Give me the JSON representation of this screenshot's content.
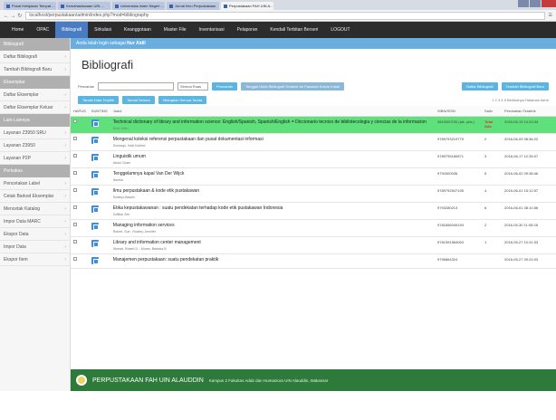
{
  "browser": {
    "tabs": [
      {
        "label": "Pusat Kebijakan Tempat ..."
      },
      {
        "label": "Kemahasiswaan UIN ..."
      },
      {
        "label": "Universitas Islam Negeri ..."
      },
      {
        "label": "Jurnal Ilmu Perpustakaan"
      },
      {
        "label": "Perpustakaan FAH UIN A..."
      }
    ],
    "url": "localhost/perpustakaan/admin/index.php?mod=bibliography",
    "nav_icons": "← → ↻"
  },
  "topnav": {
    "items": [
      "Home",
      "OPAC",
      "Bibliografi",
      "Sirkulasi",
      "Keanggotaan",
      "Master File",
      "Inventarisasi",
      "Pelaporan",
      "Kendali Terbitan Berseri",
      "LOGOUT"
    ]
  },
  "sidebar": {
    "sections": [
      {
        "heading": "Bibliografi",
        "items": [
          "Daftar Bibliografi",
          "Tambah Bibliografi Baru"
        ]
      },
      {
        "heading": "Eksemplar",
        "items": [
          "Daftar Eksemplar",
          "Daftar Eksemplar Keluar"
        ]
      },
      {
        "heading": "Lain-Lainnya",
        "items": [
          "Layanan Z3950 SRU",
          "Layanan Z3950",
          "Layanan P2P"
        ]
      },
      {
        "heading": "Perkakas",
        "items": [
          "Pencetakan Label",
          "Cetak Barkod Eksemplar",
          "Mencetak Katalog",
          "Impor Data MARC",
          "Ekspor Data",
          "Impor Data",
          "Ekspor Item"
        ]
      }
    ]
  },
  "main": {
    "info": "Anda telah login sebagai",
    "info_user": "Nur Aidil",
    "title": "Bibliografi",
    "search_label": "Pencarian",
    "search_placeholder": "",
    "search_select": "Semua Ruas",
    "btn_search": "Pencarian",
    "btn_search_pattern": "Tanggal Ubah Bibliografi Terakhir ke Pasukan Kolom Induk",
    "btn_list": "Daftar Bibliografi",
    "btn_add": "Tambah Bibliografi Baru",
    "btn_select_all": "Tandai Data Terpilih",
    "btn_clear": "Tandai Semua",
    "btn_unmark": "Hilangkan Semua Tanda",
    "pager": "1 2 3 4 5 Berikutnya Halaman Akhir",
    "columns": [
      "HAPUS",
      "SUNTING",
      "Judul",
      "ISBN/ISSN",
      "Salin",
      "Perubahan Terakhir"
    ],
    "rows": [
      {
        "title": "Technical dictionary of library and information science: English/Spanish, Spanish/English = Diccionario tecnico de bibliotecologia y ciencias de la informacion",
        "author": "Kent, Allen",
        "isbn": "0815300705 (alk. pbk.)",
        "copies": "Total Ada",
        "date": "2016-06-19 14:43:34",
        "highlight": true
      },
      {
        "title": "Mengenal koleksi referensi perpustakaan dan pusat dokumentasi informasi",
        "author": "Sumargo, Hadi Koleksi",
        "isbn": "9789793219775",
        "copies": "2",
        "date": "2016-06-09 08:36:22",
        "highlight": false
      },
      {
        "title": "Linguistik umum",
        "author": "Abdul Chaer",
        "isbn": "9789795180871",
        "copies": "3",
        "date": "2016-06-17 12:35:07",
        "highlight": false
      },
      {
        "title": "Tenggelamnya kapal Van Der Wijck",
        "author": "Hamka",
        "isbn": "9794300036",
        "copies": "5",
        "date": "2016-06-02 09:38:46",
        "highlight": false
      },
      {
        "title": "Ilmu perpustakaan & kode etik pustakawan",
        "author": "Sulistyo-Basuki",
        "isbn": "9789792547195",
        "copies": "4",
        "date": "2016-06-01 15:12:57",
        "highlight": false
      },
      {
        "title": "Etika kepustakawanan : suatu pendekatan terhadap kode etik pustakawan Indonesia",
        "author": "Zulfikar Zen",
        "isbn": "9793280213",
        "copies": "6",
        "date": "2016-06-01 08:10:56",
        "highlight": false
      },
      {
        "title": "Managing information services",
        "author": "Robert, Sue ; Rowley, Jennifer",
        "isbn": "9781856045193",
        "copies": "2",
        "date": "2016-05-30 11:05:28",
        "highlight": false
      },
      {
        "title": "Library and information center management",
        "author": "Stueart, Robert D. ; Moran, Barbara B.",
        "isbn": "9781591584063",
        "copies": "1",
        "date": "2016-05-27 10:31:33",
        "highlight": false
      },
      {
        "title": "Manajemen perpustakaan: suatu pendekatan praktik",
        "author": "",
        "isbn": "9796864324",
        "copies": "",
        "date": "2016-05-27 09:24:03",
        "highlight": false
      }
    ]
  },
  "footer": {
    "title": "PERPUSTAKAAN FAH UIN ALAUDDIN",
    "address": "Kampus 2 Fakultas Adab dan Humaniora UIN Alauddin, Makassar"
  }
}
